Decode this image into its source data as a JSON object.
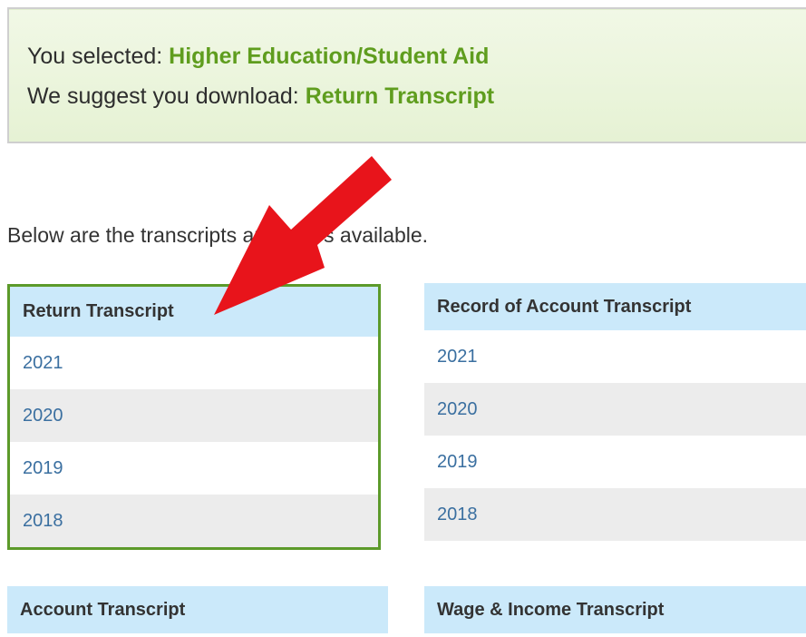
{
  "notice": {
    "selected_prefix": "You selected: ",
    "selected_value": "Higher Education/Student Aid",
    "suggest_prefix": "We suggest you download: ",
    "suggest_value": "Return Transcript"
  },
  "intro_text": "Below are the transcripts and years available.",
  "panels": {
    "return_transcript": {
      "title": "Return Transcript",
      "years": [
        "2021",
        "2020",
        "2019",
        "2018"
      ]
    },
    "record_of_account": {
      "title": "Record of Account Transcript",
      "years": [
        "2021",
        "2020",
        "2019",
        "2018"
      ]
    },
    "account_transcript": {
      "title": "Account Transcript"
    },
    "wage_income": {
      "title": "Wage & Income Transcript"
    }
  },
  "annotation": {
    "icon": "red-arrow-icon",
    "color": "#e8141b"
  }
}
